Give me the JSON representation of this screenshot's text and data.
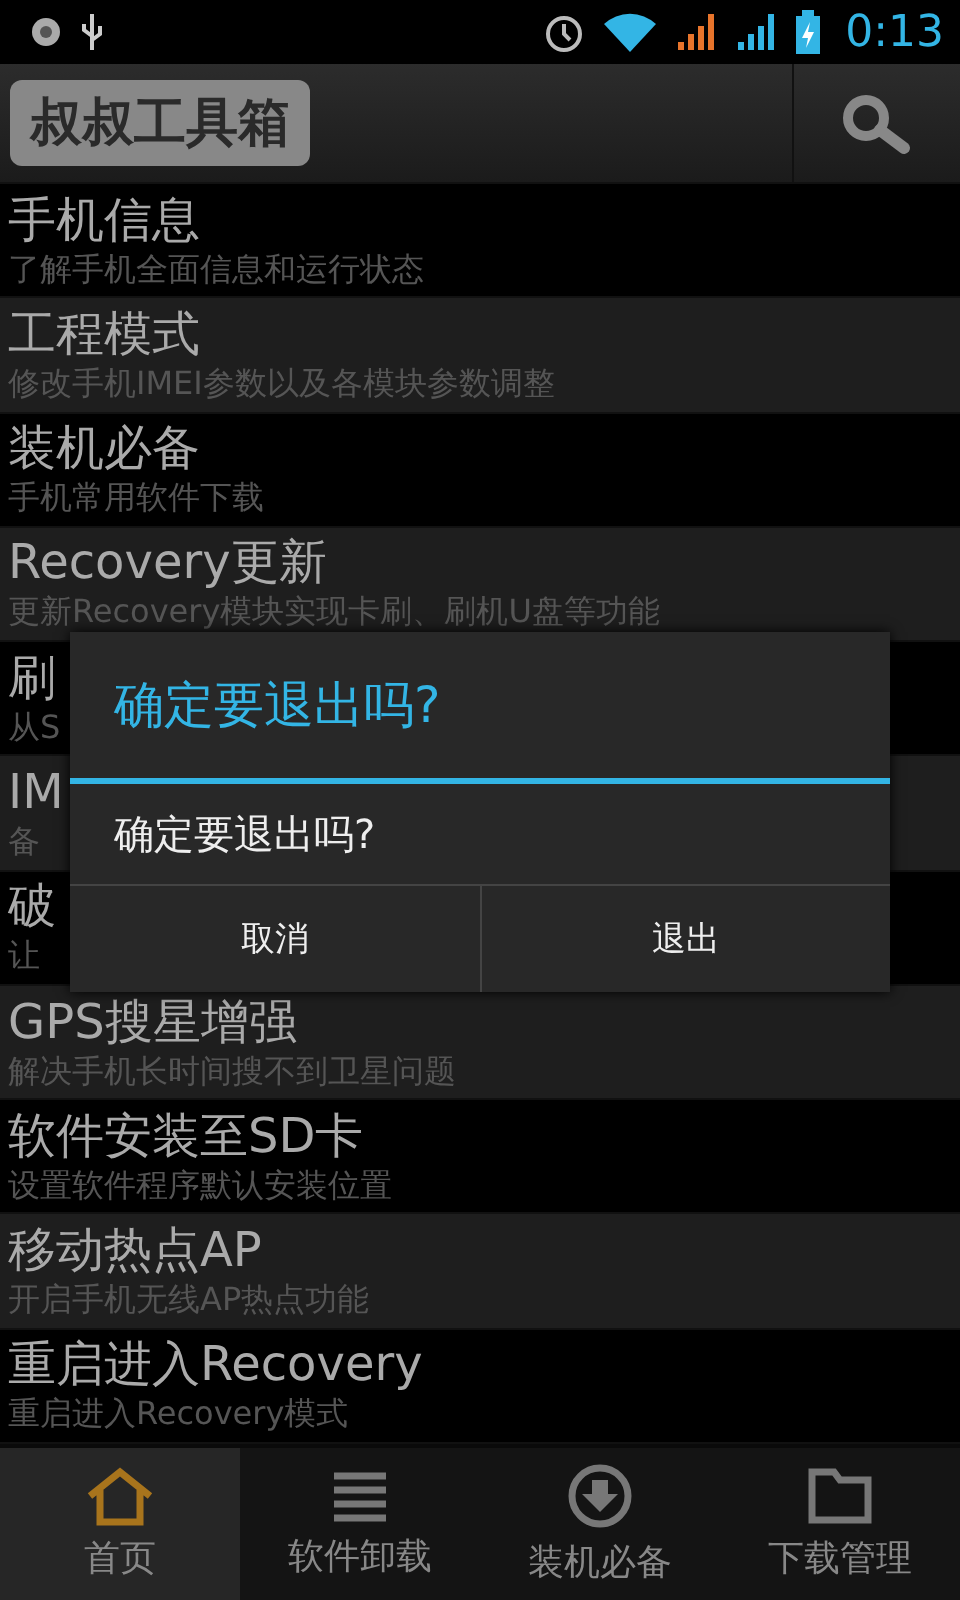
{
  "status_bar": {
    "time": "0:13"
  },
  "header": {
    "title": "叔叔工具箱"
  },
  "items": [
    {
      "title": "手机信息",
      "subtitle": "了解手机全面信息和运行状态"
    },
    {
      "title": "工程模式",
      "subtitle": "修改手机IMEI参数以及各模块参数调整"
    },
    {
      "title": "装机必备",
      "subtitle": "手机常用软件下载"
    },
    {
      "title": "Recovery更新",
      "subtitle": "更新Recovery模块实现卡刷、刷机U盘等功能"
    },
    {
      "title": "刷",
      "subtitle": "从S"
    },
    {
      "title": "IM",
      "subtitle": "备"
    },
    {
      "title": "破",
      "subtitle": "让"
    },
    {
      "title": "GPS搜星增强",
      "subtitle": "解决手机长时间搜不到卫星问题"
    },
    {
      "title": "软件安装至SD卡",
      "subtitle": "设置软件程序默认安装位置"
    },
    {
      "title": "移动热点AP",
      "subtitle": "开启手机无线AP热点功能"
    },
    {
      "title": "重启进入Recovery",
      "subtitle": "重启进入Recovery模式"
    }
  ],
  "dialog": {
    "title": "确定要退出吗?",
    "message": "确定要退出吗?",
    "buttons": [
      "取消",
      "退出"
    ]
  },
  "tabs": [
    {
      "label": "首页",
      "kind": "home",
      "selected": true
    },
    {
      "label": "软件卸载",
      "kind": "list",
      "selected": false
    },
    {
      "label": "装机必备",
      "kind": "download",
      "selected": false
    },
    {
      "label": "下载管理",
      "kind": "folder",
      "selected": false
    }
  ]
}
